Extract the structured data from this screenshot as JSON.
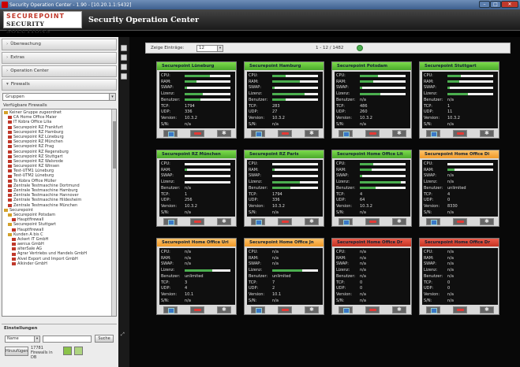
{
  "window": {
    "title": "Security Operation Center - 1.90 - [10.20.1.1:5432]"
  },
  "header": {
    "logo_line1": "SECUREPOINT",
    "logo_line2": "SECURITY SOLUTIONS",
    "title": "Security Operation Center"
  },
  "sidebar": {
    "sections": [
      {
        "label": "Überwachung",
        "arrow": "›"
      },
      {
        "label": "Extras",
        "arrow": "›"
      },
      {
        "label": "Operation Center",
        "arrow": "›"
      },
      {
        "label": "Firewalls",
        "arrow": "▾"
      }
    ],
    "group_select": "Gruppen",
    "available_label": "Verfügbare Firewalls",
    "tree": [
      {
        "label": "Keiner Gruppe zugeordnet",
        "icon": "fld",
        "indent": 0
      },
      {
        "label": "CA Home Office Maier",
        "icon": "red",
        "indent": 1
      },
      {
        "label": "IT Kobra Office Lilia",
        "icon": "red",
        "indent": 1
      },
      {
        "label": "Securepoint RZ Frankfurt",
        "icon": "red",
        "indent": 1
      },
      {
        "label": "Securepoint RZ Hamburg",
        "icon": "red",
        "indent": 1
      },
      {
        "label": "Securepoint RZ Lüneburg",
        "icon": "red",
        "indent": 1
      },
      {
        "label": "Securepoint RZ München",
        "icon": "red",
        "indent": 1
      },
      {
        "label": "Securepoint RZ Prag",
        "icon": "red",
        "indent": 1
      },
      {
        "label": "Securepoint RZ Regensburg",
        "icon": "red",
        "indent": 1
      },
      {
        "label": "Securepoint RZ Stuttgart",
        "icon": "red",
        "indent": 1
      },
      {
        "label": "Securepoint RZ Walsrode",
        "icon": "red",
        "indent": 1
      },
      {
        "label": "Securepoint RZ Winsen",
        "icon": "red",
        "indent": 1
      },
      {
        "label": "Test-UTM1 Lüneburg",
        "icon": "red",
        "indent": 1
      },
      {
        "label": "Test-UTM2 Lüneburg",
        "icon": "red",
        "indent": 1
      },
      {
        "label": "To Kobra Office Müller",
        "icon": "red",
        "indent": 1
      },
      {
        "label": "Zentrale Testmaschine Dortmund",
        "icon": "red",
        "indent": 1
      },
      {
        "label": "Zentrale Testmaschine Hamburg",
        "icon": "red",
        "indent": 1
      },
      {
        "label": "Zentrale Testmaschine Hannover",
        "icon": "red",
        "indent": 1
      },
      {
        "label": "Zentrale Testmaschine Hildesheim",
        "icon": "red",
        "indent": 1
      },
      {
        "label": "Zentrale Testmaschine München",
        "icon": "red",
        "indent": 1
      },
      {
        "label": "Securepoint",
        "icon": "fld",
        "indent": 0
      },
      {
        "label": "Securepoint Potsdam",
        "icon": "fld",
        "indent": 1
      },
      {
        "label": "Hauptfirewall",
        "icon": "red",
        "indent": 2
      },
      {
        "label": "Securepoint Stuttgart",
        "icon": "fld",
        "indent": 1
      },
      {
        "label": "Hauptfirewall",
        "icon": "red",
        "indent": 2
      },
      {
        "label": "Kunden A bis C",
        "icon": "fld",
        "indent": 1
      },
      {
        "label": "Ackert IT GmbH",
        "icon": "red",
        "indent": 2
      },
      {
        "label": "aenius GmbH",
        "icon": "red",
        "indent": 2
      },
      {
        "label": "alterSale AG",
        "icon": "red",
        "indent": 2
      },
      {
        "label": "Agrar Vertriebs und Handels GmbH",
        "icon": "red",
        "indent": 2
      },
      {
        "label": "Alvel Export und Import GmbH",
        "icon": "red",
        "indent": 2
      },
      {
        "label": "Alkinder GmbH",
        "icon": "red",
        "indent": 2
      }
    ],
    "search": {
      "heading": "Einstellungen",
      "field": "Name",
      "button": "Suche",
      "add_button": "Hinzufügen",
      "count_text": "17781 Firewalls in DB"
    }
  },
  "toolbar": {
    "per_page_label": "Zeige Einträge:",
    "per_page": "12",
    "page_info": "1 - 12 / 1482"
  },
  "cards": [
    {
      "title": "Securepoint Lüneburg",
      "status": "green",
      "cpu": 0.55,
      "ram": 0.25,
      "swap": 0.05,
      "lizenz": 0.4,
      "benutzer": 0.35,
      "tcp": "1794",
      "udp": "336",
      "version": "10.3.2",
      "sn": "n/a"
    },
    {
      "title": "Securepoint Hamburg",
      "status": "green",
      "cpu": 0.3,
      "ram": 0.6,
      "swap": 0.05,
      "lizenz": 0.7,
      "benutzer": 0.3,
      "tcp": "283",
      "udp": "27",
      "version": "10.3.2",
      "sn": "n/a"
    },
    {
      "title": "Securepoint Potsdam",
      "status": "green",
      "cpu": 0.4,
      "ram": 0.3,
      "swap": 0.05,
      "lizenz": 0.45,
      "benutzer": "n/a",
      "tcp": "486",
      "udp": "260",
      "version": "10.3.2",
      "sn": "n/a"
    },
    {
      "title": "Securepoint Stuttgart",
      "status": "green",
      "cpu": 0.3,
      "ram": 0.25,
      "swap": 0.05,
      "lizenz": 0.45,
      "benutzer": "n/a",
      "tcp": "1",
      "udp": "11",
      "version": "10.3.2",
      "sn": "n/a"
    },
    {
      "title": "Securepoint RZ München",
      "status": "green",
      "cpu": 0.0,
      "ram": 0.05,
      "swap": 0.0,
      "lizenz": 0.0,
      "benutzer": "n/a",
      "tcp": "1",
      "udp": "256",
      "version": "10.3.2",
      "sn": "n/a"
    },
    {
      "title": "Securepoint RZ Paris",
      "status": "green",
      "cpu": 0.0,
      "ram": 0.05,
      "swap": 0.0,
      "lizenz": 0.6,
      "benutzer": 0.4,
      "tcp": "1794",
      "udp": "336",
      "version": "10.3.2",
      "sn": "n/a"
    },
    {
      "title": "Securepoint Home Office Lit",
      "status": "green",
      "cpu": 0.3,
      "ram": 0.25,
      "swap": 0.05,
      "lizenz": 0.9,
      "benutzer": 0.35,
      "tcp": "4",
      "udp": "64",
      "version": "10.3.2",
      "sn": "n/a"
    },
    {
      "title": "Securepoint Home Office Di",
      "status": "orange",
      "cpu": 0.0,
      "ram": 0.15,
      "swap": "n/a",
      "lizenz": "n/a",
      "benutzer": "unlimited",
      "tcp": "4",
      "udp": "0",
      "version": "8330",
      "sn": "n/a"
    },
    {
      "title": "Securepoint Home Office Uri",
      "status": "orange",
      "cpu": "n/a",
      "ram": "n/a",
      "swap": "n/a",
      "lizenz": 0.6,
      "benutzer": "unlimited",
      "tcp": "3",
      "udp": "4",
      "version": "10.1",
      "sn": "n/a"
    },
    {
      "title": "Securepoint Home Office Jn",
      "status": "orange",
      "cpu": "n/a",
      "ram": "n/a",
      "swap": "n/a",
      "lizenz": 0.65,
      "benutzer": "unlimited",
      "tcp": "7",
      "udp": "2",
      "version": "10.1",
      "sn": "n/a"
    },
    {
      "title": "Securepoint Home Office Dr",
      "status": "red",
      "cpu": "n/a",
      "ram": "n/a",
      "swap": "n/a",
      "lizenz": "n/a",
      "benutzer": "n/a",
      "tcp": "0",
      "udp": "0",
      "version": "n/a",
      "sn": "n/a"
    },
    {
      "title": "Securepoint Home Office Dr",
      "status": "red",
      "cpu": "n/a",
      "ram": "n/a",
      "swap": "n/a",
      "lizenz": "n/a",
      "benutzer": "n/a",
      "tcp": "0",
      "udp": "0",
      "version": "n/a",
      "sn": "n/a"
    }
  ],
  "row_labels": {
    "cpu": "CPU:",
    "ram": "RAM:",
    "swap": "SWAP:",
    "lizenz": "Lizenz:",
    "benutzer": "Benutzer:",
    "tcp": "TCP:",
    "udp": "UDP:",
    "version": "Version:",
    "sn": "S/N:"
  }
}
